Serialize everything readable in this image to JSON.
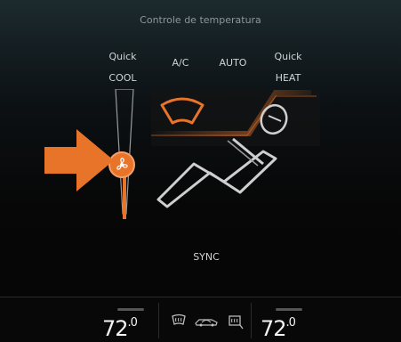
{
  "header": {
    "title": "Controle de temperatura"
  },
  "modes": {
    "quick_cool": {
      "line1": "Quick",
      "line2": "COOL"
    },
    "ac": {
      "label": "A/C"
    },
    "auto": {
      "label": "AUTO"
    },
    "quick_heat": {
      "line1": "Quick",
      "line2": "HEAT"
    }
  },
  "sync": {
    "label": "SYNC"
  },
  "temperature": {
    "left": {
      "value": "72",
      "decimal": ".0"
    },
    "right": {
      "value": "72",
      "decimal": ".0"
    }
  },
  "icons": {
    "fan_knob": "fan-icon",
    "rear_defrost": "rear-defrost-icon",
    "recirculation": "recirculation-icon",
    "seat_heat": "seat-heat-icon",
    "pointer": "arrow-icon"
  },
  "fan_level": 0.35,
  "colors": {
    "accent": "#e8742a",
    "text": "#d0d4d6",
    "temp": "#f4f4f4"
  }
}
